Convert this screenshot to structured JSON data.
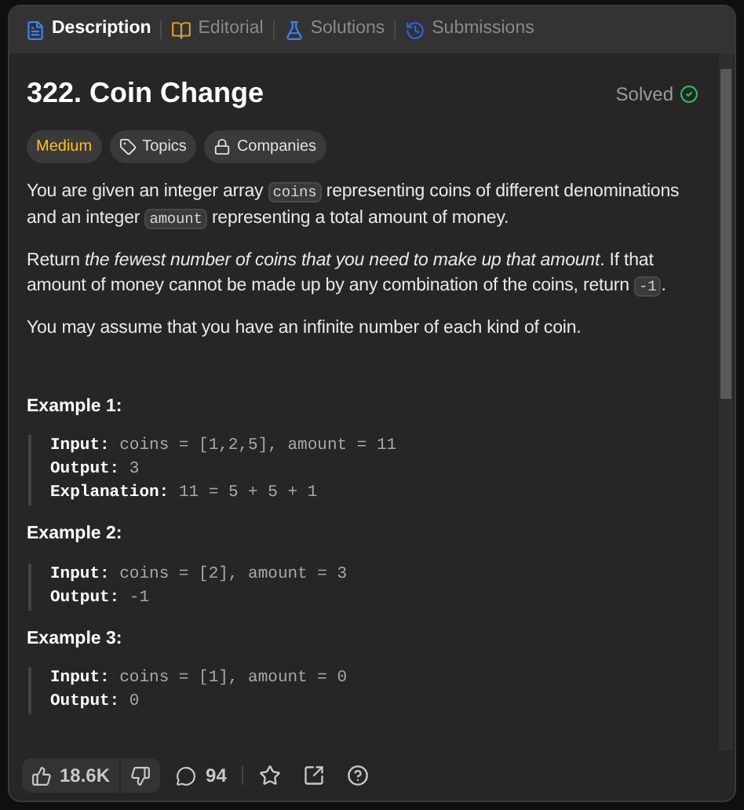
{
  "tabs": [
    {
      "label": "Description",
      "kind": "description",
      "selected": true
    },
    {
      "label": "Editorial",
      "kind": "editorial",
      "selected": false
    },
    {
      "label": "Solutions",
      "kind": "solutions",
      "selected": false
    },
    {
      "label": "Submissions",
      "kind": "submissions",
      "selected": false
    }
  ],
  "problem": {
    "title": "322. Coin Change",
    "status": "Solved",
    "difficulty": "Medium",
    "tags": [
      {
        "label": "Topics",
        "kind": "tag"
      },
      {
        "label": "Companies",
        "kind": "lock"
      }
    ]
  },
  "paragraphs": [
    [
      {
        "kind": "text",
        "text": "You are given an integer array "
      },
      {
        "kind": "code",
        "text": "coins"
      },
      {
        "kind": "text",
        "text": " representing coins of different denominations and an integer "
      },
      {
        "kind": "code",
        "text": "amount"
      },
      {
        "kind": "text",
        "text": " representing a total amount of money."
      }
    ],
    [
      {
        "kind": "text",
        "text": "Return *the fewest number of coins that you need to make up that amount*. If that amount of money cannot be made up by any combination of the coins, return "
      },
      {
        "kind": "code",
        "text": "-1"
      },
      {
        "kind": "text",
        "text": "."
      }
    ],
    [
      {
        "kind": "text",
        "text": "You may assume that you have an infinite number of each kind of coin."
      }
    ]
  ],
  "examples": [
    {
      "title": "Example 1:",
      "lines": [
        {
          "label": "Input:",
          "value": "coins = [1,2,5], amount = 11"
        },
        {
          "label": "Output:",
          "value": "3"
        },
        {
          "label": "Explanation:",
          "value": "11 = 5 + 5 + 1"
        }
      ]
    },
    {
      "title": "Example 2:",
      "lines": [
        {
          "label": "Input:",
          "value": "coins = [2], amount = 3"
        },
        {
          "label": "Output:",
          "value": "-1"
        }
      ]
    },
    {
      "title": "Example 3:",
      "lines": [
        {
          "label": "Input:",
          "value": "coins = [1], amount = 0"
        },
        {
          "label": "Output:",
          "value": "0"
        }
      ]
    }
  ],
  "footer": {
    "likes": "18.6K",
    "comments": "94"
  }
}
